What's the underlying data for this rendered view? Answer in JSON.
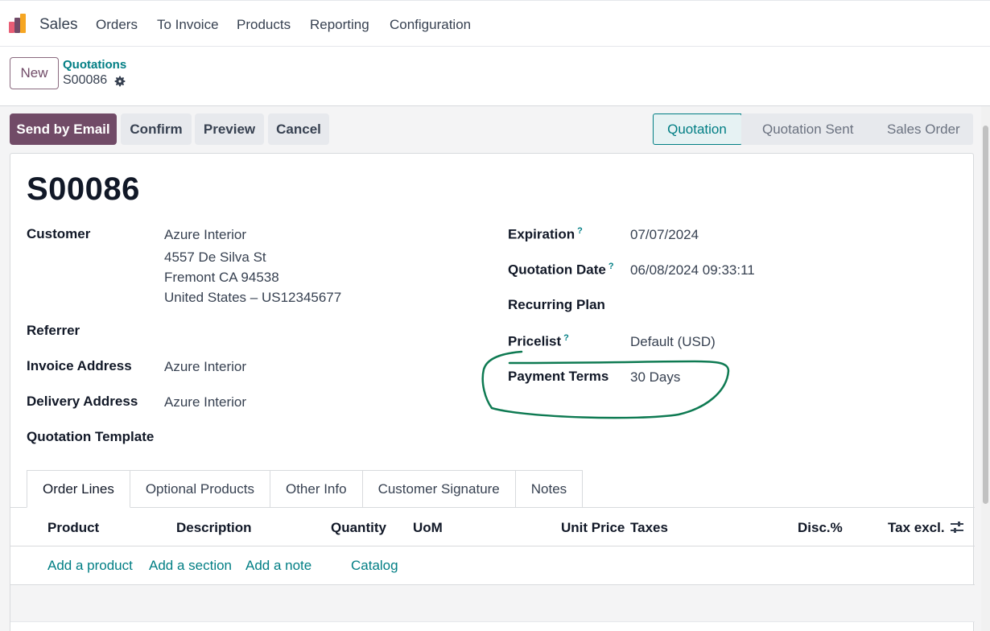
{
  "navbar": {
    "app_name": "Sales",
    "menu": [
      "Orders",
      "To Invoice",
      "Products",
      "Reporting",
      "Configuration"
    ]
  },
  "control_panel": {
    "new_label": "New",
    "breadcrumb_parent": "Quotations",
    "breadcrumb_current": "S00086"
  },
  "actions": {
    "send_email": "Send by Email",
    "confirm": "Confirm",
    "preview": "Preview",
    "cancel": "Cancel"
  },
  "status": {
    "steps": [
      "Quotation",
      "Quotation Sent",
      "Sales Order"
    ],
    "active": "Quotation"
  },
  "record": {
    "title": "S00086",
    "left_fields": {
      "customer_label": "Customer",
      "customer_name": "Azure Interior",
      "customer_addr1": "4557 De Silva St",
      "customer_addr2": "Fremont CA 94538",
      "customer_addr3": "United States – US12345677",
      "referrer_label": "Referrer",
      "invoice_address_label": "Invoice Address",
      "invoice_address_value": "Azure Interior",
      "delivery_address_label": "Delivery Address",
      "delivery_address_value": "Azure Interior",
      "template_label": "Quotation Template"
    },
    "right_fields": {
      "expiration_label": "Expiration",
      "expiration_value": "07/07/2024",
      "quotation_date_label": "Quotation Date",
      "quotation_date_value": "06/08/2024 09:33:11",
      "recurring_label": "Recurring Plan",
      "pricelist_label": "Pricelist",
      "pricelist_value": "Default (USD)",
      "payment_terms_label": "Payment Terms",
      "payment_terms_value": "30 Days",
      "help_mark": "?"
    }
  },
  "tabs": [
    "Order Lines",
    "Optional Products",
    "Other Info",
    "Customer Signature",
    "Notes"
  ],
  "order_table": {
    "columns": [
      "Product",
      "Description",
      "Quantity",
      "UoM",
      "Unit Price",
      "Taxes",
      "Disc.%",
      "Tax excl."
    ],
    "add_links": [
      "Add a product",
      "Add a section",
      "Add a note",
      "Catalog"
    ]
  },
  "colors": {
    "brand": "#714B67",
    "accent": "#017e84",
    "annotation": "#0e7a52"
  }
}
